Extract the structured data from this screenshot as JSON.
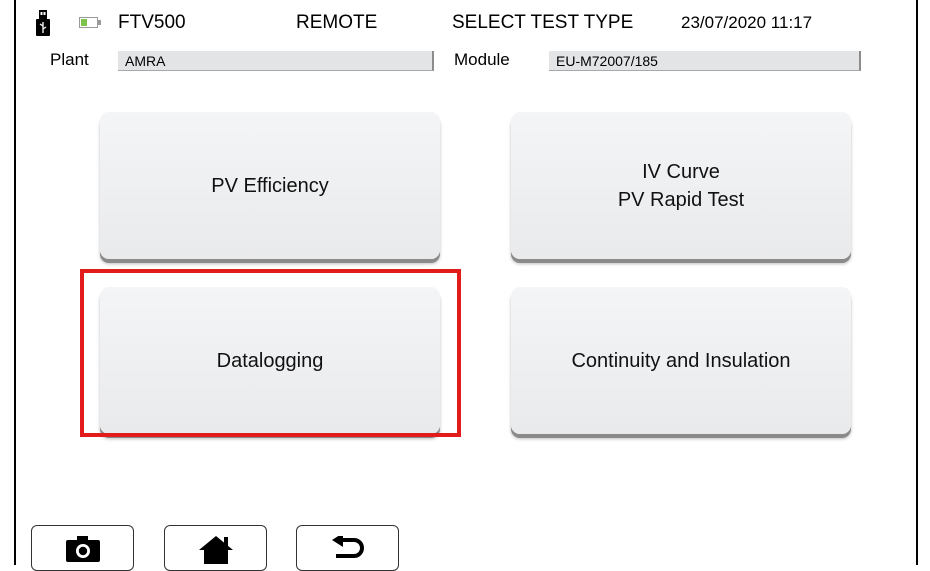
{
  "header": {
    "device": "FTV500",
    "mode": "REMOTE",
    "screen_title": "SELECT TEST TYPE",
    "datetime": "23/07/2020 11:17"
  },
  "fields": {
    "plant_label": "Plant",
    "plant_value": "AMRA",
    "module_label": "Module",
    "module_value": "EU-M72007/185"
  },
  "tests": [
    {
      "line1": "PV Efficiency",
      "line2": ""
    },
    {
      "line1": "IV Curve",
      "line2": "PV Rapid Test"
    },
    {
      "line1": "Datalogging",
      "line2": ""
    },
    {
      "line1": "Continuity and Insulation",
      "line2": ""
    }
  ],
  "highlight_color": "#e21b1b",
  "nav": [
    "camera-icon",
    "home-icon",
    "back-icon"
  ],
  "status_icons": [
    "usb-icon",
    "battery-icon"
  ]
}
